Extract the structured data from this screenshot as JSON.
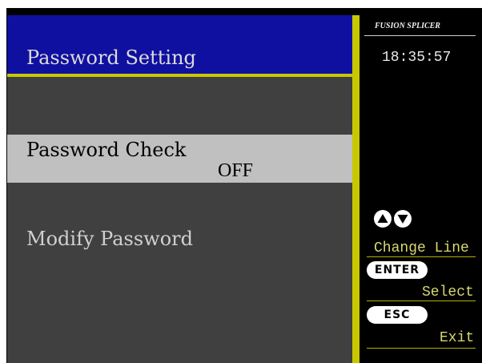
{
  "header": {
    "title": "Password Setting"
  },
  "menu": {
    "items": [
      {
        "label": "Password Check",
        "value": "OFF",
        "selected": true
      },
      {
        "label": "Modify Password",
        "selected": false
      }
    ]
  },
  "side_panel": {
    "brand": "FUSION SPLICER",
    "clock": "18:35:57",
    "icons": {
      "up": "arrow-up-icon",
      "down": "arrow-down-icon"
    },
    "help": {
      "change_line": "Change Line",
      "enter_key": "ENTER",
      "select": "Select",
      "esc_key": "ESC",
      "exit": "Exit"
    }
  },
  "colors": {
    "header_bg": "#1010a0",
    "accent_yellow": "#c8c800",
    "menu_bg": "#404040",
    "selected_bg": "#c0c0c0",
    "side_bg": "#000000"
  }
}
